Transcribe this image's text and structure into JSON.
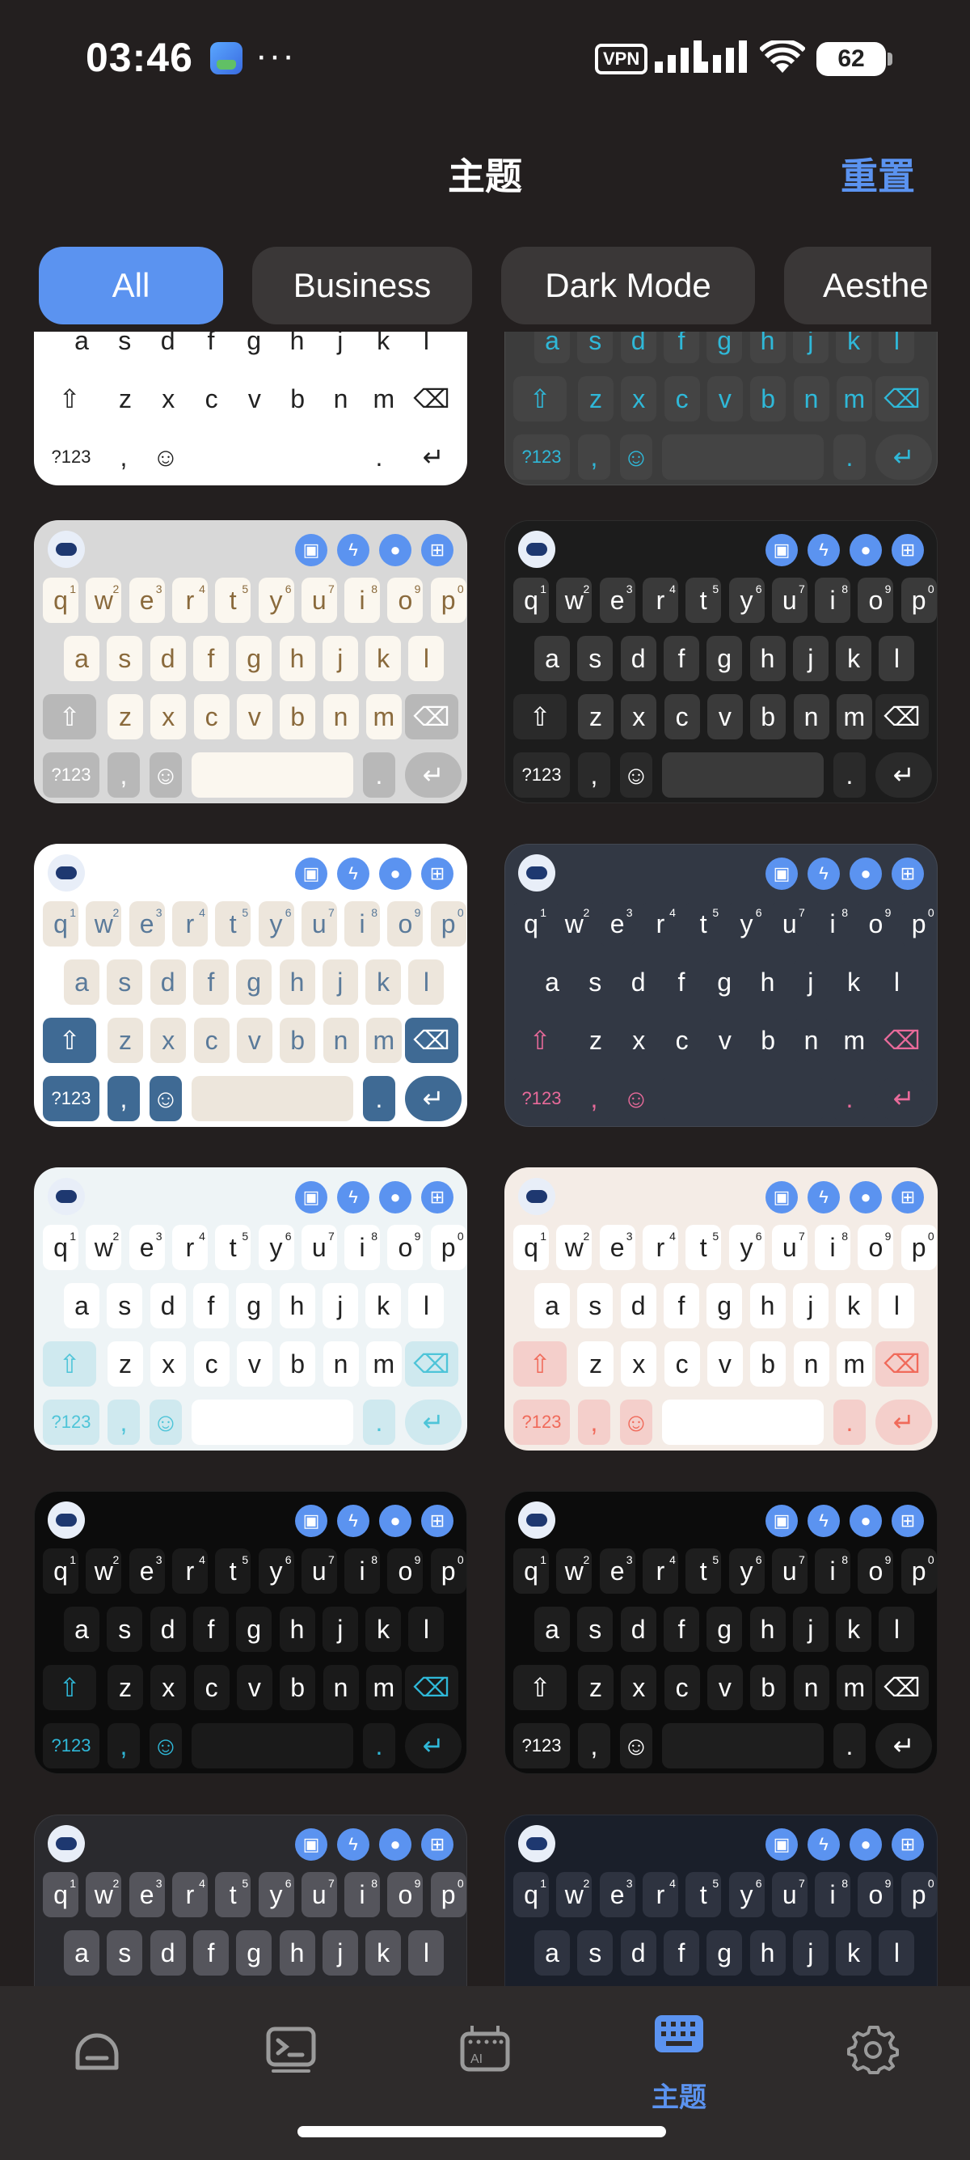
{
  "status_bar": {
    "time": "03:46",
    "more": "···",
    "vpn": "VPN",
    "battery": "62"
  },
  "header": {
    "title": "主题",
    "reset": "重置"
  },
  "tabs": [
    {
      "label": "All",
      "active": true
    },
    {
      "label": "Business",
      "active": false
    },
    {
      "label": "Dark Mode",
      "active": false
    },
    {
      "label": "Aesthe",
      "active": false
    }
  ],
  "keyboard_labels": {
    "row1": [
      "q",
      "w",
      "e",
      "r",
      "t",
      "y",
      "u",
      "i",
      "o",
      "p"
    ],
    "row2": [
      "a",
      "s",
      "d",
      "f",
      "g",
      "h",
      "j",
      "k",
      "l"
    ],
    "row3": [
      "z",
      "x",
      "c",
      "v",
      "b",
      "n",
      "m"
    ],
    "numbers": [
      "1",
      "2",
      "3",
      "4",
      "5",
      "6",
      "7",
      "8",
      "9",
      "0"
    ],
    "sym": "?123",
    "comma": ",",
    "period": "."
  },
  "themes": [
    {
      "name": "classic-white",
      "bg": "#ffffff",
      "key": "#ffffff",
      "text": "#222222",
      "special": "#ffffff",
      "accent": "#222222"
    },
    {
      "name": "dark-cyan",
      "bg": "#3c3c3c",
      "key": "#444444",
      "text": "#2fb8d8",
      "special": "#444444",
      "accent": "#2fb8d8"
    },
    {
      "name": "marble",
      "bg": "#d8d8d8",
      "key": "#fbf7ef",
      "text": "#8a6a3c",
      "special": "#b8b8b8",
      "accent": "#ffffff"
    },
    {
      "name": "glass-black",
      "bg": "#1c1c1c",
      "key": "#3a3a3a",
      "text": "#ffffff",
      "special": "#2a2a2a",
      "accent": "#ffffff"
    },
    {
      "name": "navy-beige",
      "bg": "#ffffff",
      "key": "#ede6dc",
      "text": "#5a7a9a",
      "special": "#3f6a94",
      "accent": "#ffffff"
    },
    {
      "name": "slate-pink",
      "bg": "#323844",
      "key": "#323844",
      "text": "#ffffff",
      "special": "#323844",
      "accent": "#e86a9a"
    },
    {
      "name": "ice-blue",
      "bg": "#eef4f6",
      "key": "#ffffff",
      "text": "#222222",
      "special": "#cfe9ef",
      "accent": "#4ec4d8"
    },
    {
      "name": "peach",
      "bg": "#f4ece6",
      "key": "#ffffff",
      "text": "#222222",
      "special": "#f4cfcb",
      "accent": "#f06a5a"
    },
    {
      "name": "neon-cyan",
      "bg": "#0c0c0c",
      "key": "#1a1a1a",
      "text": "#ffffff",
      "special": "#1a1a1a",
      "accent": "#2fb8d8"
    },
    {
      "name": "midnight",
      "bg": "#0c0c0c",
      "key": "#1e1e1e",
      "text": "#ffffff",
      "special": "#1e1e1e",
      "accent": "#ffffff"
    },
    {
      "name": "steel-grey",
      "bg": "#2a2a2e",
      "key": "#55555c",
      "text": "#ffffff",
      "special": "#55555c",
      "accent": "#ffffff"
    },
    {
      "name": "navy-dark",
      "bg": "#1a1f2a",
      "key": "#2e3340",
      "text": "#ffffff",
      "special": "#2e3340",
      "accent": "#ffffff"
    }
  ],
  "bottom_nav": [
    {
      "name": "home",
      "label": ""
    },
    {
      "name": "terminal",
      "label": ""
    },
    {
      "name": "ai-keyboard",
      "label": ""
    },
    {
      "name": "theme",
      "label": "主题",
      "active": true
    },
    {
      "name": "settings",
      "label": ""
    }
  ]
}
